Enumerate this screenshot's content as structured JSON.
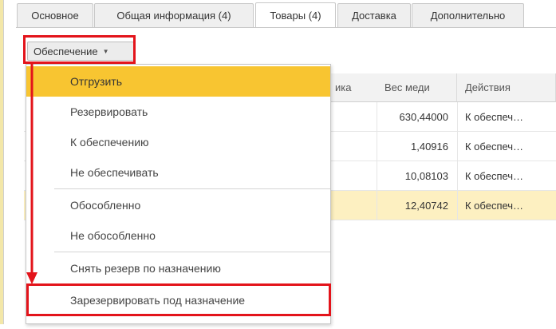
{
  "tabs": [
    "Основное",
    "Общая информация (4)",
    "Товары (4)",
    "Доставка",
    "Дополнительно"
  ],
  "active_tab": "Товары (4)",
  "toolbar": {
    "provision_button": "Обеспечение"
  },
  "table": {
    "headers": {
      "partial": "ика",
      "copper_weight": "Вес меди",
      "actions": "Действия"
    },
    "rows": [
      {
        "weight": "630,44000",
        "action": "К обеспеч…"
      },
      {
        "weight": "1,40916",
        "action": "К обеспеч…"
      },
      {
        "weight": "10,08103",
        "action": "К обеспеч…"
      },
      {
        "weight": "12,40742",
        "action": "К обеспеч…"
      }
    ]
  },
  "menu": {
    "items": [
      "Отгрузить",
      "Резервировать",
      "К обеспечению",
      "Не обеспечивать",
      "Обособленно",
      "Не обособленно",
      "Снять резерв по назначению",
      "Зарезервировать под назначение"
    ],
    "highlighted": "Отгрузить"
  },
  "colors": {
    "highlight": "#f8c531",
    "annotation": "#e3141b",
    "selected_row": "#fdf0c1"
  }
}
